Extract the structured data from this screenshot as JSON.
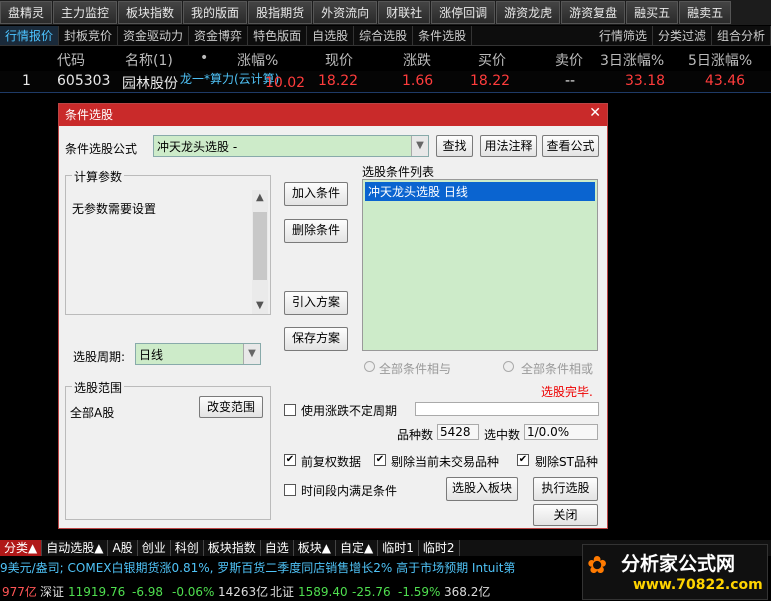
{
  "topbar": [
    "盘精灵",
    "主力监控",
    "板块指数",
    "我的版面",
    "股指期货",
    "外资流向",
    "财联社",
    "涨停回调",
    "游资龙虎",
    "游资复盘",
    "融买五",
    "融卖五"
  ],
  "tabs": [
    "行情报价",
    "封板竞价",
    "资金驱动力",
    "资金博弈",
    "特色版面",
    "自选股",
    "综合选股",
    "条件选股"
  ],
  "tabs_right": [
    "行情筛选",
    "分类过滤",
    "组合分析"
  ],
  "header": {
    "code": "代码",
    "name": "名称(1)",
    "dot": "•",
    "pct": "涨幅%",
    "price": "现价",
    "chg": "涨跌",
    "bid": "买价",
    "ask": "卖价",
    "pct3": "3日涨幅%",
    "pct5": "5日涨幅%"
  },
  "row": {
    "idx": "1",
    "code": "605303",
    "name": "园林股份",
    "overlay": "龙一*算力(云计算)",
    "pct": "10.02",
    "price": "18.22",
    "chg": "1.66",
    "bid": "18.22",
    "ask": "--",
    "pct3": "33.18",
    "pct5": "43.46"
  },
  "dialog": {
    "title": "条件选股",
    "close": "✕",
    "formula_label": "条件选股公式",
    "formula_value": "冲天龙头选股  -",
    "btn_find": "查找",
    "btn_usage": "用法注释",
    "btn_view": "查看公式",
    "params_title": "计算参数",
    "params_text": "无参数需要设置",
    "list_title": "选股条件列表",
    "list_item": "冲天龙头选股  日线",
    "btn_add": "加入条件",
    "btn_del": "删除条件",
    "btn_import": "引入方案",
    "btn_save": "保存方案",
    "period_label": "选股周期:",
    "period_value": "日线",
    "radio_and": "全部条件相与",
    "radio_or": "全部条件相或",
    "done": "选股完毕.",
    "range_title": "选股范围",
    "range_value": "全部A股",
    "btn_range": "改变范围",
    "chk_unfixed": "使用涨跌不定周期",
    "count_label": "品种数",
    "count_value": "5428",
    "sel_label": "选中数",
    "sel_value": "1/0.0%",
    "chk_fq": "前复权数据",
    "chk_untraded": "剔除当前未交易品种",
    "chk_st": "剔除ST品种",
    "chk_time": "时间段内满足条件",
    "btn_board": "选股入板块",
    "btn_exec": "执行选股",
    "btn_close": "关闭"
  },
  "bottom_tabs": [
    "分类▲",
    "自动选股▲",
    "A股",
    "创业",
    "科创",
    "板块指数",
    "自选",
    "板块▲",
    "自定▲",
    "临时1",
    "临时2"
  ],
  "ticker": "9美元/盎司;  COMEX白银期货涨0.81%,   罗斯百货二季度同店销售增长2% 高于市场预期        Intuit第",
  "status": {
    "a": "977亿",
    "b": "深证",
    "c": "11919.76",
    "d": "-6.98",
    "e": "-0.06%",
    "f": "14263亿",
    "g": "北证",
    "h": "1589.40",
    "i": "-25.76",
    "j": "-1.59%",
    "k": "368.2亿"
  },
  "logo": {
    "main": "分析家公式网",
    "url": "www.70822.com"
  }
}
